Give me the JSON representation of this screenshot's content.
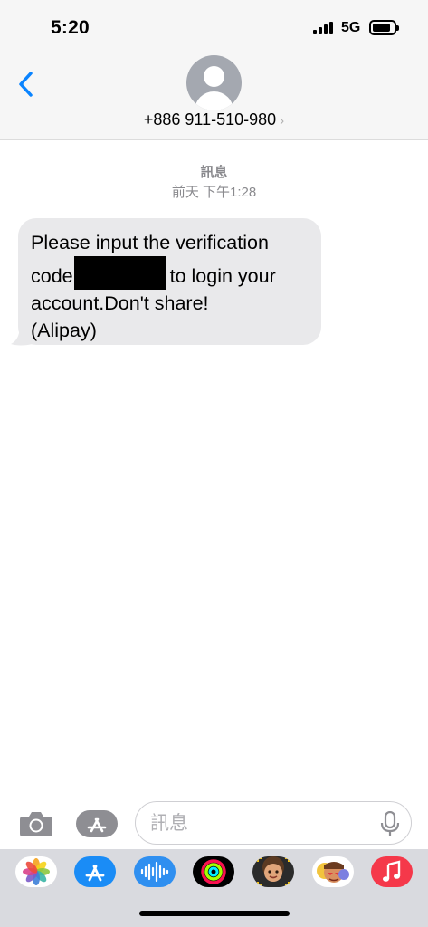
{
  "status_bar": {
    "time": "5:20",
    "network": "5G"
  },
  "header": {
    "back_icon": "chevron-left-icon",
    "avatar_icon": "person-avatar-icon",
    "contact_name": "+886 911-510-980",
    "contact_chevron": "›"
  },
  "conversation": {
    "service_label": "訊息",
    "timestamp": "前天 下午1:28",
    "message": {
      "line1": "Please input the verification",
      "line2_pre": "code",
      "line2_post": "to login your",
      "line3": "account.Don't share!",
      "line4": "(Alipay)"
    }
  },
  "composer": {
    "camera_icon": "camera-icon",
    "apps_icon": "app-store-icon",
    "placeholder": "訊息",
    "value": "",
    "mic_icon": "microphone-icon"
  },
  "app_drawer": {
    "apps": [
      "photos-icon",
      "app-store-icon",
      "audio-message-icon",
      "activity-icon",
      "memoji-icon",
      "animoji-stickers-icon",
      "music-icon"
    ]
  },
  "colors": {
    "accent": "#0a84ff",
    "bubble": "#e9e9eb",
    "bar": "#f6f6f6",
    "drawer": "#d9dadf"
  }
}
